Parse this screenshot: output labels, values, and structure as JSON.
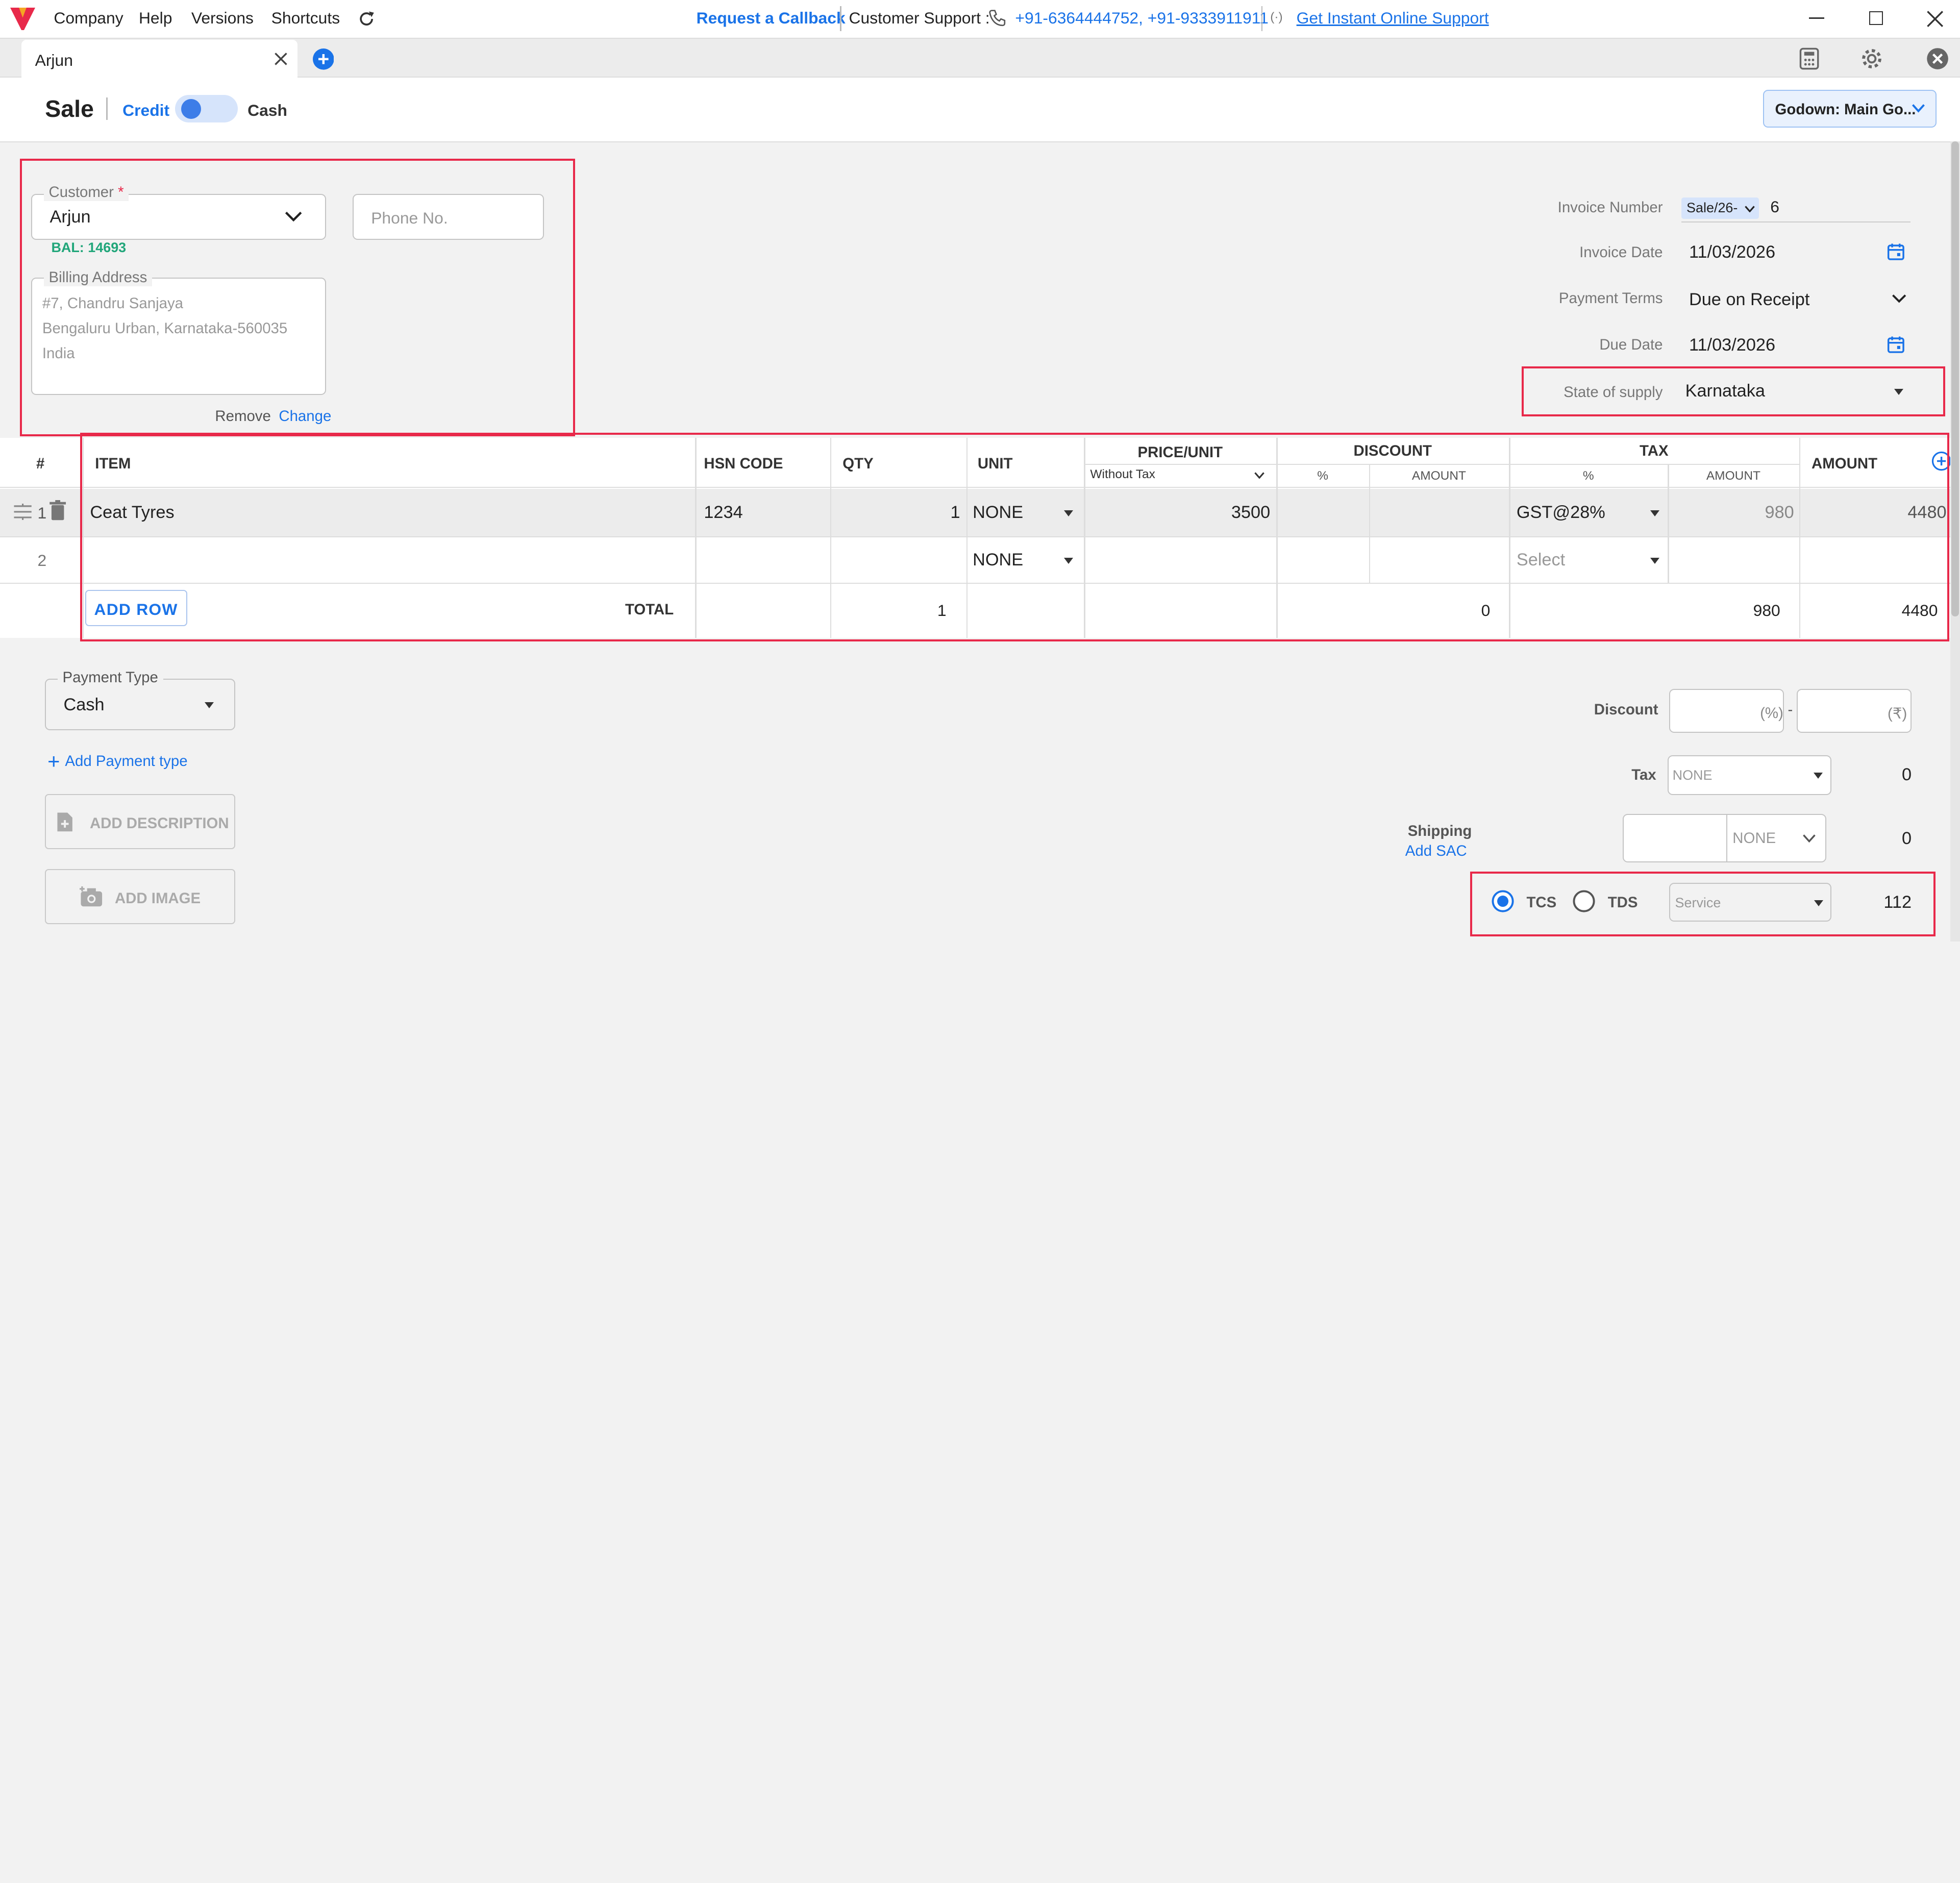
{
  "menubar": {
    "items": [
      "Company",
      "Help",
      "Versions",
      "Shortcuts"
    ],
    "callback": "Request a Callback",
    "support_label": "Customer Support :",
    "support_phones": "+91-6364444752, +91-9333911911",
    "online_support": "Get Instant Online Support"
  },
  "tab": {
    "name": "Arjun"
  },
  "header": {
    "title": "Sale",
    "credit": "Credit",
    "cash": "Cash",
    "godown": "Godown: Main Go..."
  },
  "customer": {
    "label": "Customer",
    "required": "*",
    "value": "Arjun",
    "balance": "BAL: 14693",
    "phone_placeholder": "Phone No.",
    "billing_label": "Billing Address",
    "address_line1": "#7, Chandru Sanjaya",
    "address_line2": "Bengaluru Urban, Karnataka-560035",
    "address_line3": "India",
    "remove": "Remove",
    "change": "Change"
  },
  "invoice": {
    "number_label": "Invoice Number",
    "prefix": "Sale/26-",
    "number": "6",
    "date_label": "Invoice Date",
    "date": "11/03/2026",
    "terms_label": "Payment Terms",
    "terms": "Due on Receipt",
    "due_label": "Due Date",
    "due": "11/03/2026",
    "state_label": "State of supply",
    "state": "Karnataka"
  },
  "table": {
    "headers": {
      "num": "#",
      "item": "ITEM",
      "hsn": "HSN CODE",
      "qty": "QTY",
      "unit": "UNIT",
      "price": "PRICE/UNIT",
      "price_sub": "Without Tax",
      "discount": "DISCOUNT",
      "disc_pct": "%",
      "disc_amt": "AMOUNT",
      "tax": "TAX",
      "tax_pct": "%",
      "tax_amt": "AMOUNT",
      "amount": "AMOUNT"
    },
    "rows": [
      {
        "num": "1",
        "item": "Ceat Tyres",
        "hsn": "1234",
        "qty": "1",
        "unit": "NONE",
        "price": "3500",
        "tax": "GST@28%",
        "tax_amt": "980",
        "amount": "4480"
      },
      {
        "num": "2",
        "unit": "NONE",
        "tax": "Select"
      }
    ],
    "add_row": "ADD ROW",
    "total_label": "TOTAL",
    "total_qty": "1",
    "total_discount": "0",
    "total_tax": "980",
    "total_amount": "4480"
  },
  "payment": {
    "type_label": "Payment Type",
    "type": "Cash",
    "add_type": "Add Payment type",
    "add_description": "ADD DESCRIPTION",
    "add_image": "ADD IMAGE"
  },
  "summary": {
    "discount_label": "Discount",
    "pct_suffix": "(%)",
    "dash": "-",
    "rupee_suffix": "(₹)",
    "tax_label": "Tax",
    "tax_select": "NONE",
    "tax_value": "0",
    "shipping_label": "Shipping",
    "add_sac": "Add SAC",
    "shipping_select": "NONE",
    "shipping_value": "0",
    "tcs": "TCS",
    "tds": "TDS",
    "service": "Service",
    "tcs_value": "112"
  },
  "colors": {
    "accent": "#1a73e8",
    "highlight": "#e8294a",
    "balance": "#21a67a"
  }
}
